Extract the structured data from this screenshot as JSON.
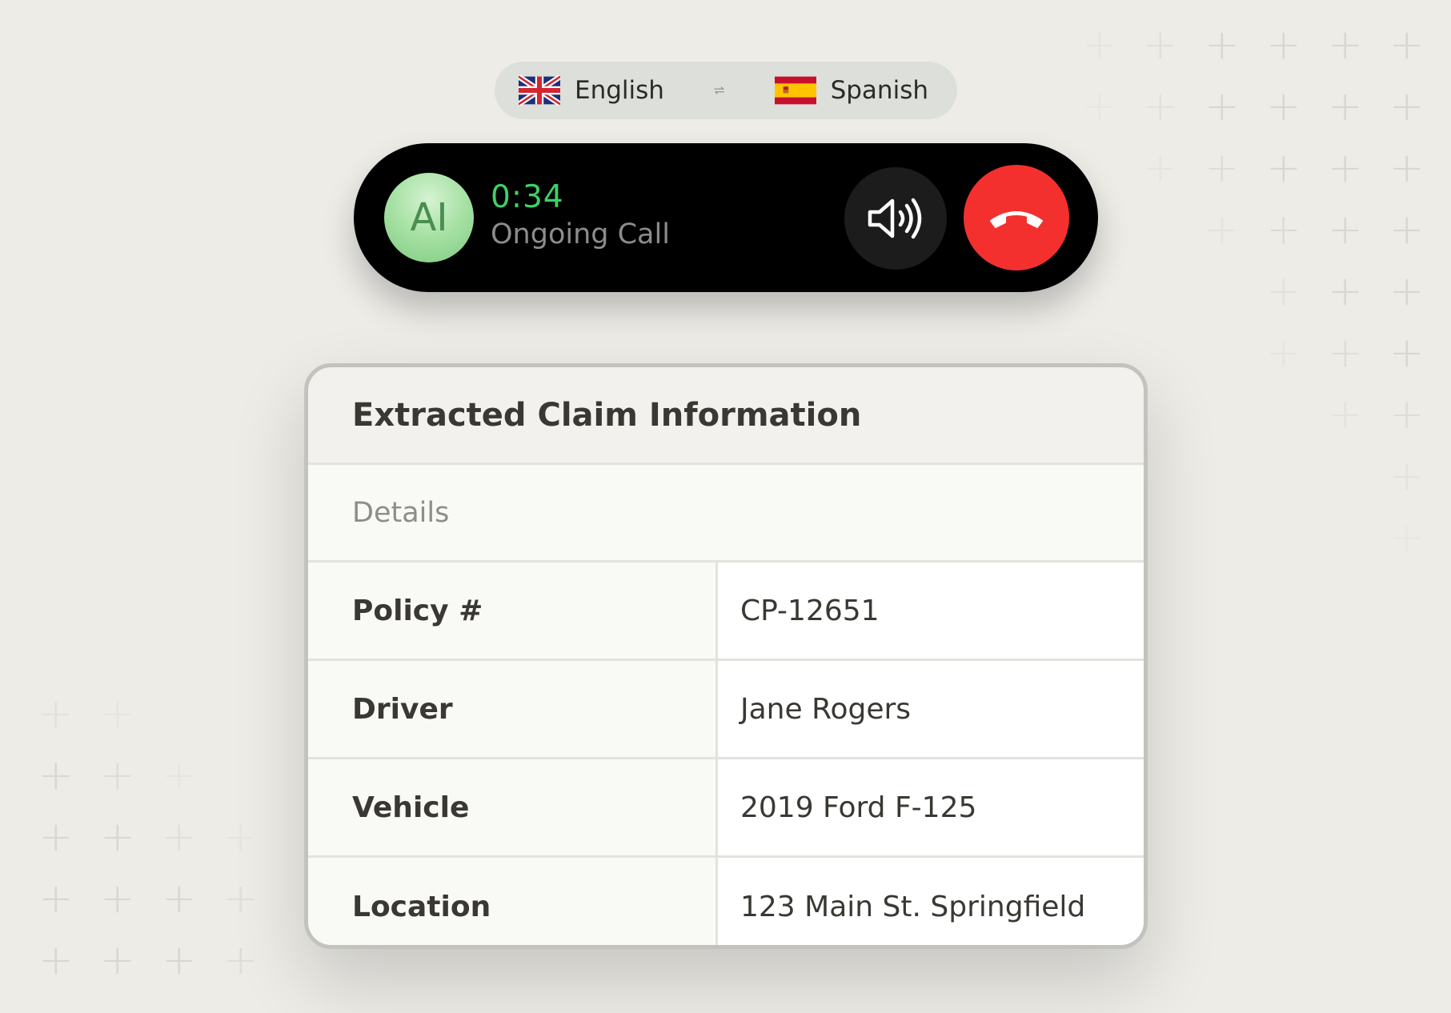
{
  "languages": {
    "source": {
      "label": "English",
      "flag": "uk-flag-icon"
    },
    "target": {
      "label": "Spanish",
      "flag": "spain-flag-icon"
    },
    "swap_icon": "swap-arrows-icon"
  },
  "call": {
    "avatar_text": "AI",
    "timer": "0:34",
    "status": "Ongoing Call",
    "speaker_icon": "speaker-icon",
    "end_icon": "hang-up-icon",
    "colors": {
      "timer": "#3dd167",
      "end_button": "#f4302e"
    }
  },
  "claim_card": {
    "title": "Extracted Claim Information",
    "section": "Details",
    "rows": [
      {
        "label": "Policy #",
        "value": "CP-12651"
      },
      {
        "label": "Driver",
        "value": "Jane Rogers"
      },
      {
        "label": "Vehicle",
        "value": "2019 Ford F-125"
      },
      {
        "label": "Location",
        "value": "123 Main St. Springfield"
      }
    ]
  }
}
